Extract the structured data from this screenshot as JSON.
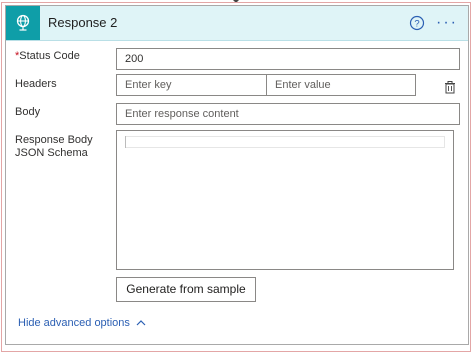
{
  "header": {
    "title": "Response 2",
    "help_icon": "question-circle-icon",
    "more_icon": "ellipsis-icon",
    "more_label": "···",
    "app_icon": "globe-icon",
    "accent_color": "#0f9ea8"
  },
  "fields": {
    "status_code": {
      "label": "Status Code",
      "required_mark": "*",
      "value": "200"
    },
    "headers": {
      "label": "Headers",
      "key_placeholder": "Enter key",
      "value_placeholder": "Enter value",
      "delete_icon": "trash-icon"
    },
    "body": {
      "label": "Body",
      "placeholder": "Enter response content"
    },
    "schema": {
      "label": "Response Body JSON Schema"
    }
  },
  "actions": {
    "generate_label": "Generate from sample",
    "advanced_label": "Hide advanced options",
    "advanced_icon": "chevron-up-icon"
  }
}
